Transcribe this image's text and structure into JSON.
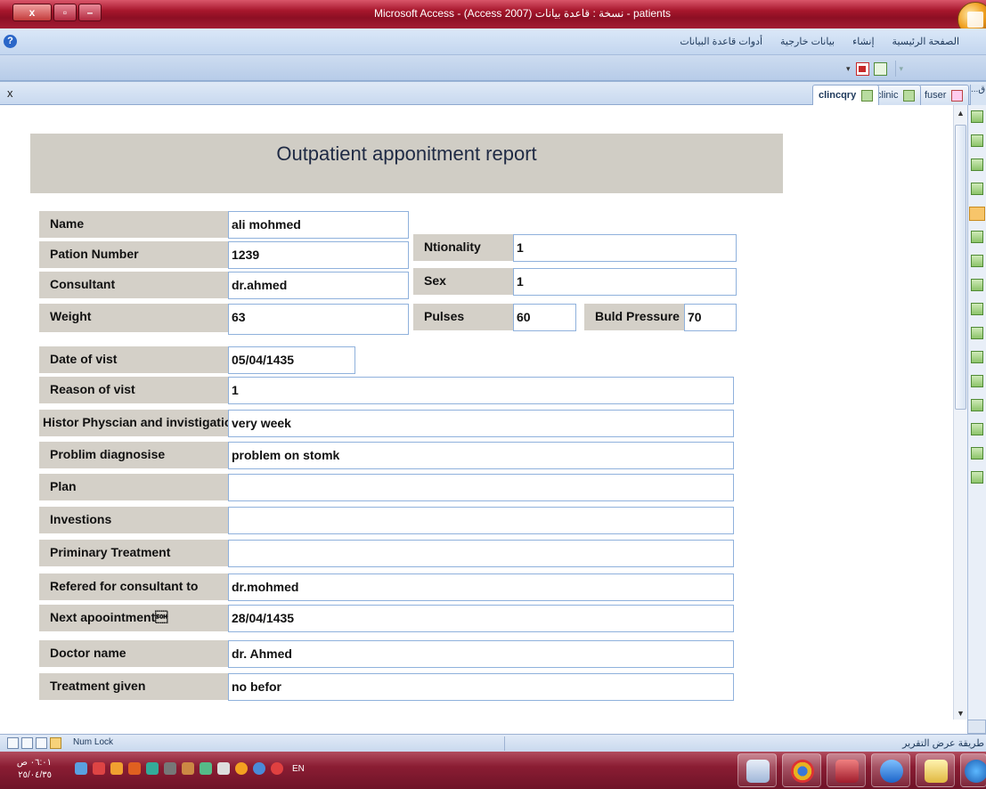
{
  "window": {
    "title": "Microsoft Access - (Access 2007) نسخة : قاعدة بيانات - patients",
    "controls": {
      "close": "x",
      "restore": "▫",
      "minimize": "–"
    }
  },
  "ribbon": {
    "tabs": [
      "الصفحة الرئيسية",
      "إنشاء",
      "بيانات خارجية",
      "أدوات قاعدة البيانات"
    ],
    "help": "?"
  },
  "quick_access": {
    "dropdown": "▾",
    "overflow": "▾"
  },
  "document_tabs": {
    "close_label": "x",
    "items": [
      {
        "label": "clincqry",
        "active": true,
        "icon": "report-icon"
      },
      {
        "label": "clinic",
        "active": false,
        "icon": "report-icon"
      },
      {
        "label": "fuser",
        "active": false,
        "icon": "form-icon"
      }
    ],
    "nav_pane_label": "...ق"
  },
  "report": {
    "title": "Outpatient apponitment report",
    "fields": {
      "name": {
        "label": "Name",
        "value": "ali mohmed"
      },
      "pation_number": {
        "label": "Pation Number",
        "value": "1239"
      },
      "consultant": {
        "label": "Consultant",
        "value": "dr.ahmed"
      },
      "weight": {
        "label": "Weight",
        "value": "63"
      },
      "nationality": {
        "label": "Ntionality",
        "value": "1"
      },
      "sex": {
        "label": "Sex",
        "value": "1"
      },
      "pulses": {
        "label": "Pulses",
        "value": "60"
      },
      "blood_pressure": {
        "label": "Buld Pressure",
        "value": "70"
      },
      "date_of_visit": {
        "label": "Date of vist",
        "value": "05/04/1435"
      },
      "reason_of_visit": {
        "label": "Reason of vist",
        "value": "1"
      },
      "history": {
        "label": "Histor Physcian and invistigation",
        "value": "very week"
      },
      "diagnosis": {
        "label": "Problim diagnosise",
        "value": "problem on stomk"
      },
      "plan": {
        "label": "Plan",
        "value": ""
      },
      "investigations": {
        "label": "Investions",
        "value": ""
      },
      "primary_treatment": {
        "label": "Priminary Treatment",
        "value": ""
      },
      "referred": {
        "label": "Refered  for consultant to",
        "value": "dr.mohmed"
      },
      "next_appointment": {
        "label": "Next apoointment\u0001",
        "value": "28/04/1435"
      },
      "doctor_name": {
        "label": "Doctor name",
        "value": "dr. Ahmed"
      },
      "treatment_given": {
        "label": "Treatment given",
        "value": "no befor"
      }
    }
  },
  "status_bar": {
    "num_lock": "Num Lock",
    "view_label": "طريقة عرض التقرير"
  },
  "taskbar": {
    "time": "٠٦:٠١ ص",
    "date": "٢٥/٠٤/٣٥",
    "language": "EN"
  },
  "colors": {
    "titlebar": "#a6162c",
    "label_bg": "#d4d0c8",
    "field_border": "#8fb1dc",
    "header_band": "#d0cdc5"
  }
}
